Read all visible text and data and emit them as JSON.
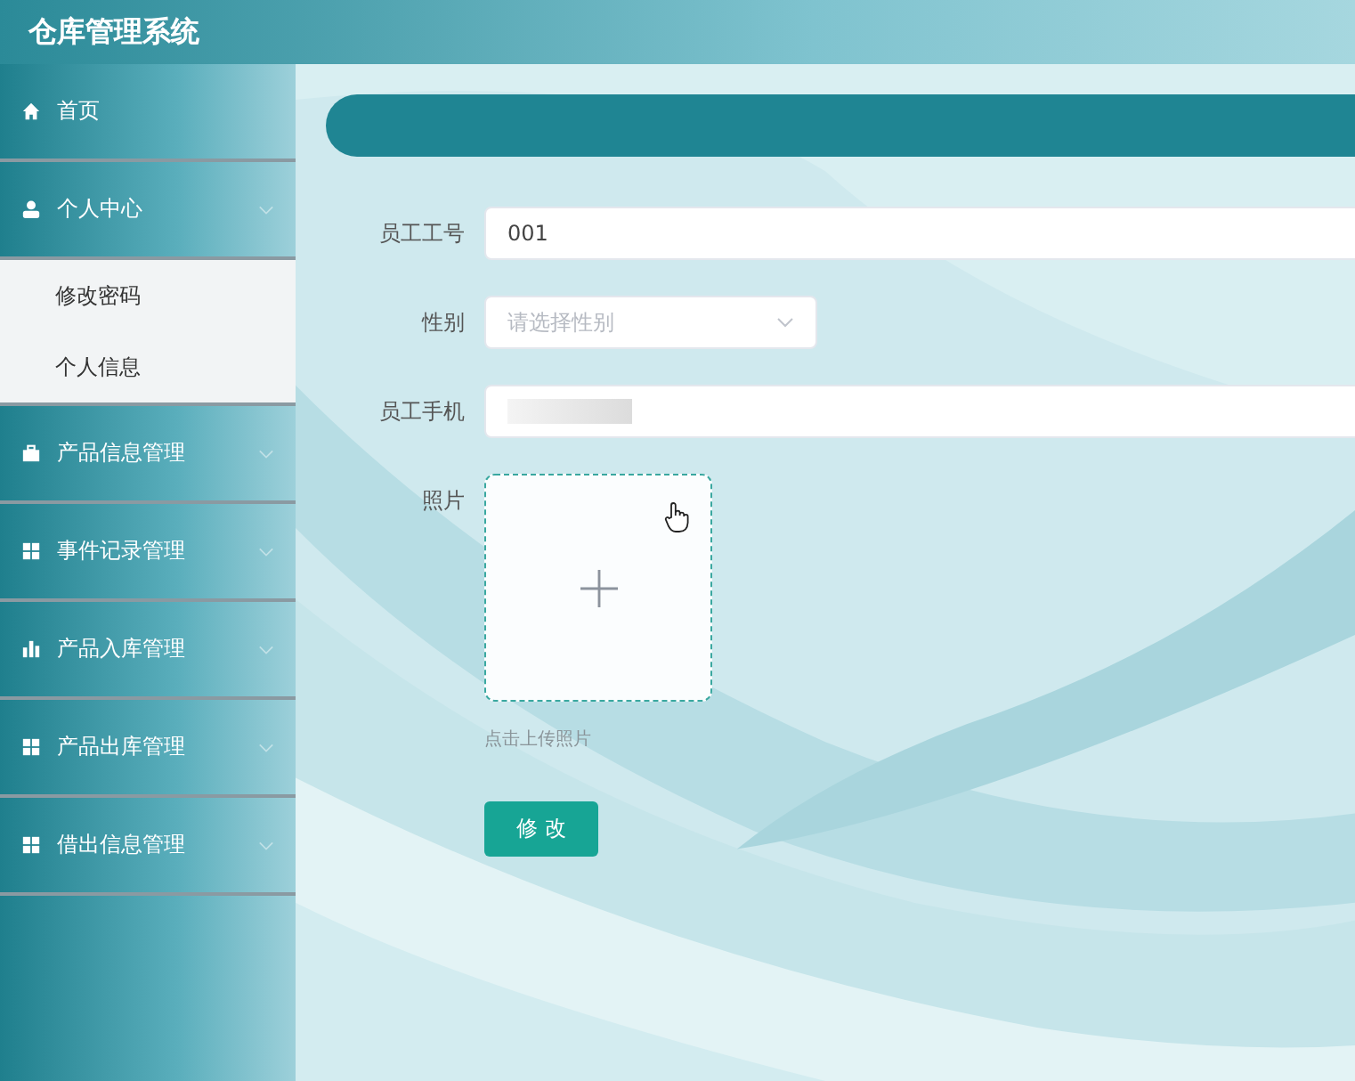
{
  "header": {
    "title": "仓库管理系统"
  },
  "sidebar": {
    "items": [
      {
        "label": "首页",
        "expandable": false,
        "expanded": false
      },
      {
        "label": "个人中心",
        "expandable": true,
        "expanded": true,
        "children": [
          {
            "label": "修改密码"
          },
          {
            "label": "个人信息"
          }
        ]
      },
      {
        "label": "产品信息管理",
        "expandable": true,
        "expanded": false
      },
      {
        "label": "事件记录管理",
        "expandable": true,
        "expanded": false
      },
      {
        "label": "产品入库管理",
        "expandable": true,
        "expanded": false
      },
      {
        "label": "产品出库管理",
        "expandable": true,
        "expanded": false
      },
      {
        "label": "借出信息管理",
        "expandable": true,
        "expanded": false
      }
    ]
  },
  "form": {
    "fields": [
      {
        "kind": "text",
        "label": "员工工号",
        "value": "001"
      },
      {
        "kind": "select",
        "label": "性别",
        "placeholder": "请选择性别"
      },
      {
        "kind": "redacted",
        "label": "员工手机"
      },
      {
        "kind": "upload",
        "label": "照片",
        "hint": "点击上传照片"
      }
    ],
    "submit": "修 改"
  }
}
